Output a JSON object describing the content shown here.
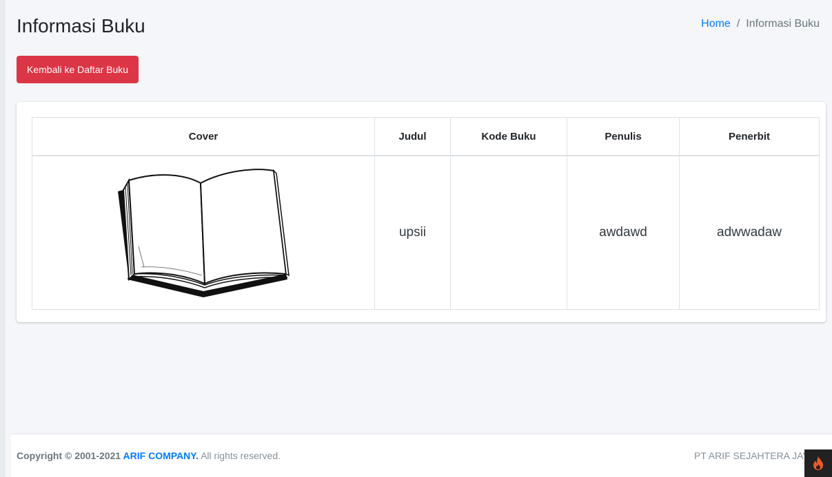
{
  "header": {
    "title": "Informasi Buku",
    "breadcrumb": {
      "home": "Home",
      "separator": "/",
      "current": "Informasi Buku"
    }
  },
  "actions": {
    "back_label": "Kembali ke Daftar Buku"
  },
  "table": {
    "columns": [
      "Cover",
      "Judul",
      "Kode Buku",
      "Penulis",
      "Penerbit"
    ],
    "rows": [
      {
        "cover_icon": "open-book-icon",
        "judul": "upsii",
        "kode_buku": "",
        "penulis": "awdawd",
        "penerbit": "adwwadaw"
      }
    ]
  },
  "footer": {
    "copyright_prefix": "Copyright © 2001-2021 ",
    "company": "ARIF COMPANY.",
    "rights": " All rights reserved.",
    "right_text": "PT ARIF SEJAHTERA JAYA"
  },
  "colors": {
    "accent": "#007bff",
    "danger": "#dc3545",
    "background": "#f4f6f9"
  }
}
